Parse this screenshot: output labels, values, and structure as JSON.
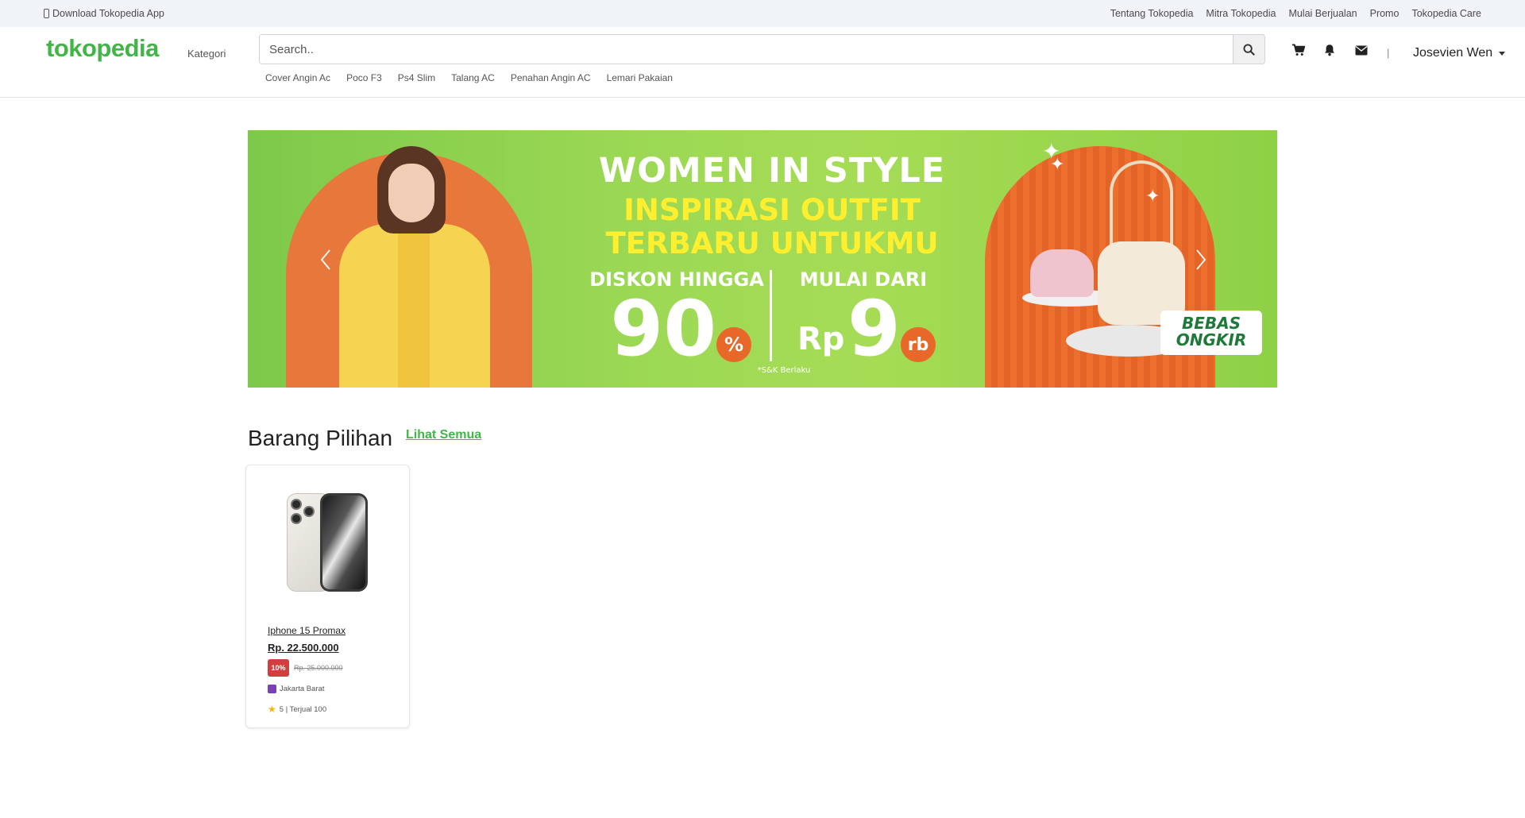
{
  "topbar": {
    "download_app": "Download Tokopedia App",
    "links": [
      "Tentang Tokopedia",
      "Mitra Tokopedia",
      "Mulai Berjualan",
      "Promo",
      "Tokopedia Care"
    ]
  },
  "header": {
    "logo": "tokopedia",
    "kategori": "Kategori",
    "search_placeholder": "Search..",
    "quick_links": [
      "Cover Angin Ac",
      "Poco F3",
      "Ps4 Slim",
      "Talang AC",
      "Penahan Angin AC",
      "Lemari Pakaian"
    ],
    "divider": "|",
    "user_name": "Josevien Wen",
    "icons": [
      "cart-icon",
      "bell-icon",
      "envelope-icon",
      "search-icon"
    ]
  },
  "banner": {
    "title": "WOMEN IN STYLE",
    "subtitle_line1": "INSPIRASI OUTFIT",
    "subtitle_line2": "TERBARU UNTUKMU",
    "diskon_label": "DISKON HINGGA",
    "diskon_value": "90",
    "diskon_unit": "%",
    "mulai_label": "MULAI DARI",
    "mulai_prefix": "Rp",
    "mulai_value": "9",
    "mulai_unit": "rb",
    "terms": "*S&K Berlaku",
    "ongkir": "BEBAS ONGKIR",
    "colors": {
      "green": "#9dd955",
      "orange": "#e8773c",
      "yellow": "#ffef2e"
    }
  },
  "section": {
    "title": "Barang Pilihan",
    "see_all": "Lihat Semua"
  },
  "products": [
    {
      "name": "Iphone 15 Promax",
      "price": "Rp. 22.500.000",
      "discount": "10%",
      "old_price": "Rp. 25.000.000",
      "location": "Jakarta Barat",
      "rating_sold": "5 | Terjual 100"
    }
  ],
  "colors": {
    "brand": "#42b549",
    "discount": "#d23e3e"
  }
}
